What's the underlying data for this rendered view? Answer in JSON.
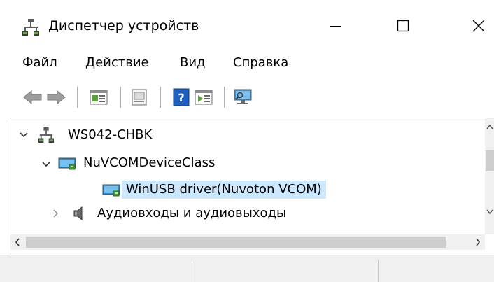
{
  "window": {
    "title": "Диспетчер устройств",
    "icon": "device-manager-icon"
  },
  "menu": [
    "Файл",
    "Действие",
    "Вид",
    "Справка"
  ],
  "toolbar": {
    "buttons": [
      "back-icon",
      "forward-icon",
      "properties-icon",
      "update-driver-icon",
      "help-icon",
      "show-hidden-icon",
      "scan-hardware-icon"
    ]
  },
  "tree": {
    "root": {
      "label": "WS042-CHBK",
      "expanded": true,
      "icon": "computer-icon"
    },
    "items": [
      {
        "label": "NuVCOMDeviceClass",
        "expanded": true,
        "icon": "usb-device-icon"
      },
      {
        "label": "WinUSB driver(Nuvoton VCOM)",
        "selected": true,
        "icon": "usb-device-icon"
      },
      {
        "label": "Аудиовходы и аудиовыходы",
        "expanded": false,
        "icon": "speaker-icon"
      }
    ]
  },
  "colors": {
    "selection": "#cce8ff",
    "scrollbar_track": "#f0f0f0",
    "scrollbar_thumb": "#cdcdcd",
    "help_blue": "#1f5fbf"
  }
}
